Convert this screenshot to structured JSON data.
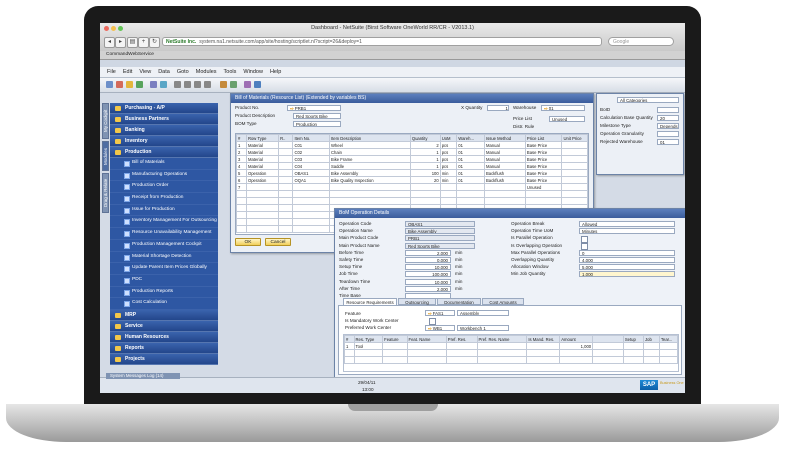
{
  "browser": {
    "title": "Dashboard - NetSuite (Birst Software OneWorld RR/CR - V2013.1)",
    "address": "system.na1.netsuite.com/app/site/hosting/scriptlet.nl?script=26&deploy=1",
    "site_badge": "NetSuite Inc.",
    "bookmark": "CommandWebService",
    "search_placeholder": "Google"
  },
  "menu": [
    "File",
    "Edit",
    "View",
    "Data",
    "Goto",
    "Modules",
    "Tools",
    "Window",
    "Help"
  ],
  "vertical_tabs": [
    "My Cockpit",
    "Modules",
    "Drag & Relate"
  ],
  "sidebar": {
    "top_modules": [
      "Purchasing - A/P",
      "Business Partners",
      "Banking",
      "Inventory",
      "Production"
    ],
    "production_items": [
      "Bill of Materials",
      "Manufacturing Operations",
      "Production Order",
      "Receipt from Production",
      "Issue for Production",
      "Inventory Management For Outsourcing",
      "Resource Unavailability Management",
      "Production Management Cockpit",
      "Material Shortage Detection",
      "Update Parent Item Prices Globally",
      "PDC",
      "Production Reports",
      "Cost Calculation"
    ],
    "bottom_modules": [
      "MRP",
      "Service",
      "Human Resources",
      "Reports",
      "Projects"
    ]
  },
  "bom": {
    "title": "Bill of Materials (Resource List) (Extended by variables BS)",
    "product_no_label": "Product No.",
    "product_no": "PRB1",
    "product_desc_label": "Product Description",
    "product_desc": "Red Sports Bike",
    "bom_type_label": "BOM Type",
    "bom_type": "Production",
    "x_quantity_label": "X Quantity",
    "x_quantity": "1",
    "warehouse_label": "Warehouse",
    "warehouse": "01",
    "price_list_label": "Price List",
    "price_list": "Unused",
    "distr_rule_label": "Distr. Rule",
    "columns": [
      "#",
      "Row Type",
      "R..",
      "Item No.",
      "Item Description",
      "Quantity",
      "UoM",
      "Wareh...",
      "Issue Method",
      "Price List",
      "Unit Price"
    ],
    "rows": [
      [
        "1",
        "Material",
        "",
        "C01",
        "Wheel",
        "2",
        "pcs",
        "01",
        "Manual",
        "Base Price",
        ""
      ],
      [
        "2",
        "Material",
        "",
        "C02",
        "Chain",
        "1",
        "pcs",
        "01",
        "Manual",
        "Base Price",
        ""
      ],
      [
        "3",
        "Material",
        "",
        "C03",
        "Bike Frame",
        "1",
        "pcs",
        "01",
        "Manual",
        "Base Price",
        ""
      ],
      [
        "4",
        "Material",
        "",
        "C04",
        "Saddle",
        "1",
        "pcs",
        "01",
        "Manual",
        "Base Price",
        ""
      ],
      [
        "5",
        "Operation",
        "",
        "OBAS1",
        "Bike Assembly",
        "100",
        "min",
        "01",
        "Backflush",
        "Base Price",
        ""
      ],
      [
        "6",
        "Operation",
        "",
        "OQA1",
        "Bike Quality Inspection",
        "20",
        "min",
        "01",
        "Backflush",
        "Base Price",
        ""
      ],
      [
        "7",
        "",
        "",
        "",
        "",
        "",
        "",
        "",
        "",
        "Unused",
        ""
      ]
    ],
    "ok_label": "OK",
    "cancel_label": "Cancel"
  },
  "rightpanel": {
    "dropdown": "All Categories",
    "rows": [
      {
        "label": "BoID",
        "value": ""
      },
      {
        "label": "Calculation Base Quantity",
        "value": "20"
      },
      {
        "label": "Milestone Type",
        "value": "Depends on"
      },
      {
        "label": "Operation Granularity",
        "value": ""
      },
      {
        "label": "Rejected Warehouse",
        "value": "01"
      }
    ]
  },
  "ops": {
    "title": "BoM Operation Details",
    "left_rows": [
      {
        "label": "Operation Code",
        "value": "OBAS1",
        "unit": ""
      },
      {
        "label": "Operation Name",
        "value": "Bike Assembly",
        "unit": ""
      },
      {
        "label": "Main Product Code",
        "value": "PRB1",
        "unit": ""
      },
      {
        "label": "Main Product Name",
        "value": "Red Sports Bike",
        "unit": ""
      },
      {
        "label": "Before Time",
        "value": "2,000",
        "unit": "min"
      },
      {
        "label": "Safety Time",
        "value": "0,000",
        "unit": "min"
      },
      {
        "label": "Setup Time",
        "value": "10,000",
        "unit": "min"
      },
      {
        "label": "Job Time",
        "value": "100,000",
        "unit": "min"
      },
      {
        "label": "Teardown Time",
        "value": "10,000",
        "unit": "min"
      },
      {
        "label": "After Time",
        "value": "2,000",
        "unit": "min"
      },
      {
        "label": "Time Base",
        "value": "",
        "unit": ""
      }
    ],
    "right_rows": [
      {
        "label": "Operation Break",
        "value": "Allowed"
      },
      {
        "label": "Operation Time UoM",
        "value": "Minutes"
      },
      {
        "label": "Is Parallel Operation",
        "value": ""
      },
      {
        "label": "Is Overlapping Operation",
        "value": ""
      },
      {
        "label": "Max Parallel Operations",
        "value": "0"
      },
      {
        "label": "Overlapping Quantity",
        "value": "4,000"
      },
      {
        "label": "Allocation Window",
        "value": "5,000"
      },
      {
        "label": "Min Job Quantity",
        "value": "1,000"
      }
    ],
    "tabs": [
      "Resource Requirements",
      "Outsourcing",
      "Documentation",
      "Cost Amounts"
    ],
    "feature_label": "Feature",
    "feature_code": "FAS1",
    "feature_name": "Assembly",
    "mandatory_label": "Is Mandatory Work Center",
    "preferred_label": "Preferred Work Center",
    "preferred_code": "WB1",
    "preferred_name": "Workbench 1",
    "grid_cols": [
      "#",
      "Res. Type",
      "Feature",
      "Feat. Name",
      "Pref. Res.",
      "Pref. Res. Name",
      "Is Mand. Res.",
      "Amount",
      "",
      "Setup",
      "Job",
      "Tear..."
    ],
    "grid_rows": [
      [
        "1",
        "Tool",
        "",
        "",
        "",
        "",
        "",
        "1,000",
        "",
        "",
        "",
        ""
      ]
    ]
  },
  "status": {
    "messages_tab": "System Messages Log (14)",
    "date": "29/04/11",
    "time": "13:00",
    "logo": "SAP",
    "logo_sub": "Business One"
  }
}
